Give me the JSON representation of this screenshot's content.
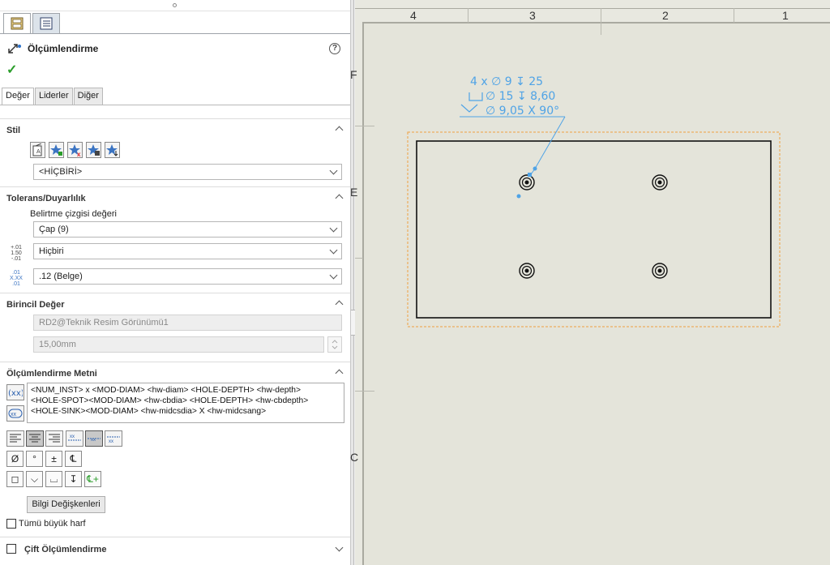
{
  "panel": {
    "manager_tabs": [
      {
        "name": "property-manager-tab",
        "icon": "property-manager-icon"
      },
      {
        "name": "configuration-tab",
        "icon": "list-icon"
      }
    ],
    "title": "Ölçümlendirme",
    "help_glyph": "?",
    "ok_glyph": "✓",
    "sub_tabs": [
      "Değer",
      "Liderler",
      "Diğer"
    ],
    "style": {
      "header": "Stil",
      "selected": "<HİÇBİRİ>"
    },
    "tolerance": {
      "header": "Tolerans/Duyarlılık",
      "callout_label": "Belirtme çizgisi değeri",
      "callout_value": "Çap (9)",
      "tolerance_type": "Hiçbiri",
      "precision": ".12 (Belge)",
      "tol_icon_lines": [
        "+.01",
        "1.50",
        "-.01"
      ],
      "prec_icon_lines": [
        ".01",
        "X.XX",
        ".01"
      ]
    },
    "primary": {
      "header": "Birincil Değer",
      "reference": "RD2@Teknik Resim Görünümü1",
      "value": "15,00mm"
    },
    "dim_text": {
      "header": "Ölçümlendirme Metni",
      "text": "<NUM_INST> x <MOD-DIAM> <hw-diam> <HOLE-DEPTH> <hw-depth>\n<HOLE-SPOT><MOD-DIAM> <hw-cbdia> <HOLE-DEPTH> <hw-cbdepth>\n<HOLE-SINK><MOD-DIAM> <hw-midcsdia> X <hw-midcsang>",
      "symbols_row1": [
        "Ø",
        "°",
        "±",
        "℄"
      ],
      "symbols_row2": [
        "◻",
        "⌵",
        "⌴",
        "↧",
        "℄+"
      ],
      "variables_button": "Bilgi Değişkenleri",
      "all_caps_label": "Tümü büyük harf"
    },
    "dual": {
      "header": "Çift Ölçümlendirme"
    }
  },
  "drawing": {
    "zones_top": [
      "4",
      "3",
      "2",
      "1"
    ],
    "zones_left": [
      "F",
      "E",
      "C"
    ],
    "callout_lines": [
      "4 x ∅ 9 ↧ 25",
      "⌴ ∅ 15 ↧ 8,60",
      "⌵ ∅ 9,05 X 90°"
    ],
    "colors": {
      "callout": "#4fa3e6",
      "selection": "#f0a040",
      "part": "#111111"
    }
  }
}
